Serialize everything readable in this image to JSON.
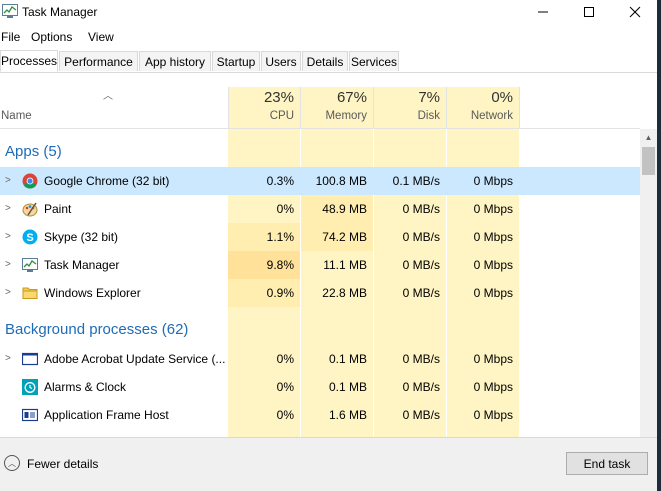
{
  "window": {
    "title": "Task Manager"
  },
  "menu": [
    "File",
    "Options",
    "View"
  ],
  "tabs": [
    "Processes",
    "Performance",
    "App history",
    "Startup",
    "Users",
    "Details",
    "Services"
  ],
  "header": {
    "name": "Name",
    "cpu": {
      "pct": "23%",
      "label": "CPU"
    },
    "memory": {
      "pct": "67%",
      "label": "Memory"
    },
    "disk": {
      "pct": "7%",
      "label": "Disk"
    },
    "network": {
      "pct": "0%",
      "label": "Network"
    }
  },
  "groups": {
    "apps": "Apps (5)",
    "background": "Background processes (62)"
  },
  "apps": [
    {
      "name": "Google Chrome (32 bit)",
      "icon": "chrome-icon",
      "cpu": "0.3%",
      "memory": "100.8 MB",
      "disk": "0.1 MB/s",
      "network": "0 Mbps"
    },
    {
      "name": "Paint",
      "icon": "paint-icon",
      "cpu": "0%",
      "memory": "48.9 MB",
      "disk": "0 MB/s",
      "network": "0 Mbps"
    },
    {
      "name": "Skype (32 bit)",
      "icon": "skype-icon",
      "cpu": "1.1%",
      "memory": "74.2 MB",
      "disk": "0 MB/s",
      "network": "0 Mbps"
    },
    {
      "name": "Task Manager",
      "icon": "task-manager-icon",
      "cpu": "9.8%",
      "memory": "11.1 MB",
      "disk": "0 MB/s",
      "network": "0 Mbps"
    },
    {
      "name": "Windows Explorer",
      "icon": "folder-icon",
      "cpu": "0.9%",
      "memory": "22.8 MB",
      "disk": "0 MB/s",
      "network": "0 Mbps"
    }
  ],
  "background": [
    {
      "name": "Adobe Acrobat Update Service (...",
      "icon": "window-icon",
      "cpu": "0%",
      "memory": "0.1 MB",
      "disk": "0 MB/s",
      "network": "0 Mbps"
    },
    {
      "name": "Alarms & Clock",
      "icon": "alarm-clock-icon",
      "cpu": "0%",
      "memory": "0.1 MB",
      "disk": "0 MB/s",
      "network": "0 Mbps"
    },
    {
      "name": "Application Frame Host",
      "icon": "app-frame-icon",
      "cpu": "0%",
      "memory": "1.6 MB",
      "disk": "0 MB/s",
      "network": "0 Mbps"
    }
  ],
  "footer": {
    "fewer_details": "Fewer details",
    "end_task": "End task"
  },
  "colors": {
    "heat_light": "#fff4c4",
    "heat_mid": "#ffeeb0",
    "heat_high": "#ffe19a",
    "selected": "#cce8ff",
    "group_text": "#1e6bb8"
  }
}
